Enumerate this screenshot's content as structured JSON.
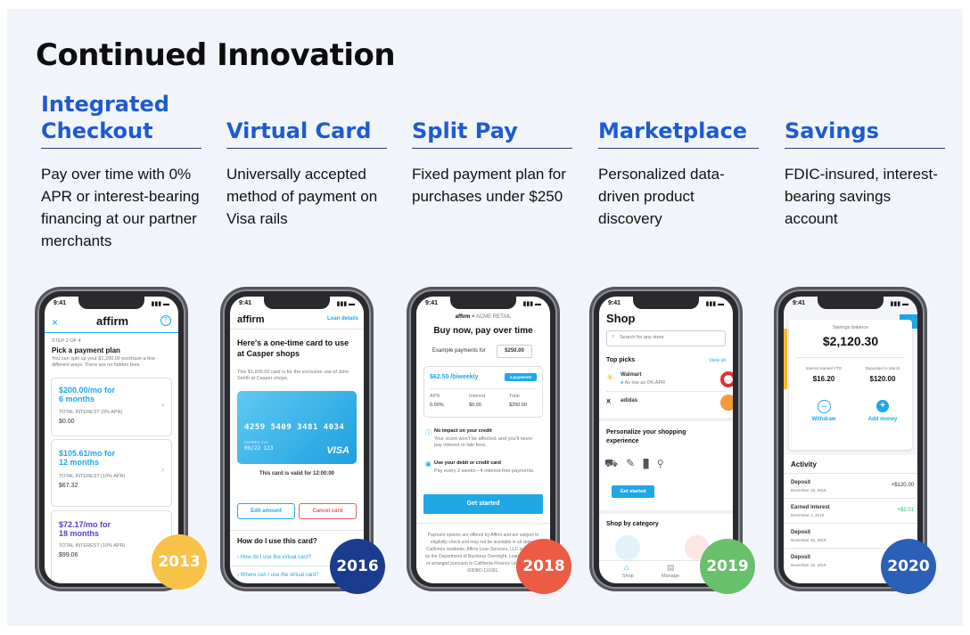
{
  "page": {
    "title": "Continued Innovation"
  },
  "columns": [
    {
      "title": "Integrated Checkout",
      "description": "Pay over time with 0% APR or interest-bearing financing at our partner merchants",
      "year": "2013",
      "badge_color": "#f7c248"
    },
    {
      "title": "Virtual Card",
      "description": "Universally accepted method of payment on Visa rails",
      "year": "2016",
      "badge_color": "#1b3b8f"
    },
    {
      "title": "Split Pay",
      "description": "Fixed payment plan for purchases under $250",
      "year": "2018",
      "badge_color": "#ec5b44"
    },
    {
      "title": "Marketplace",
      "description": "Personalized data-driven product discovery",
      "year": "2019",
      "badge_color": "#69c06a"
    },
    {
      "title": "Savings",
      "description": "FDIC-insured, interest-bearing savings account",
      "year": "2020",
      "badge_color": "#2b5fb8"
    }
  ],
  "phone1": {
    "time": "9:41",
    "close": "×",
    "logo": "affirm",
    "help": "?",
    "step": "STEP 2 OF 4",
    "heading": "Pick a payment plan",
    "sub": "You can split up your $1,200.00 purchase a few different ways. There are no hidden fees.",
    "plans": [
      {
        "amount": "$200.00/mo for 6 months",
        "label": "TOTAL INTEREST (0% APR)",
        "value": "$0.00"
      },
      {
        "amount": "$105.61/mo for 12 months",
        "label": "TOTAL INTEREST (10% APR)",
        "value": "$67.32"
      },
      {
        "amount": "$72.17/mo for 18 months",
        "label": "TOTAL INTEREST (10% APR)",
        "value": "$99.06"
      }
    ]
  },
  "phone2": {
    "time": "9:41",
    "logo": "affirm",
    "link": "Loan details",
    "heading": "Here's a one-time card to use at Casper shops",
    "sub": "This $1,200.00 card is for the exclusive use of John Smith at Casper shops.",
    "card_number": "4259 5409 3481 4034",
    "card_exp_label": "EXPIRES  CVV",
    "card_exp": "09/22  123",
    "card_brand": "VISA",
    "valid": "This card is valid for 12:00:00",
    "edit": "Edit amount",
    "cancel": "Cancel card",
    "faq_title": "How do I use this card?",
    "faq": [
      "How do I use the virtual card?",
      "Where can I use the virtual card?"
    ]
  },
  "phone3": {
    "time": "9:41",
    "logo": "affirm",
    "partner": "ACME RETAIL",
    "heading": "Buy now, pay over time",
    "example_label": "Example payments for",
    "example_value": "$250.00",
    "biweekly": "$62.50 /biweekly",
    "payments_pill": "4 payments",
    "cols": [
      "APR",
      "Interest",
      "Total"
    ],
    "vals": [
      "0.00%",
      "$0.00",
      "$250.00"
    ],
    "info1_title": "No impact on your credit",
    "info1": "Your score won't be affected, and you'll never pay interest or late fees.",
    "info2_title": "Use your debit or credit card",
    "info2": "Pay every 2 weeks—4 interest-free payments.",
    "cta": "Get started",
    "disclaimer": "Payment options are offered by Affirm and are subject to eligibility check and may not be available in all states. California residents: Affirm Loan Services, LLC is licensed by the Department of Business Oversight. Loans are made or arranged pursuant to California Finance Lender license 60DBO-111681."
  },
  "phone4": {
    "time": "9:41",
    "title": "Shop",
    "search_placeholder": "Search for any store",
    "top_picks": "Top picks",
    "view_all": "View all",
    "stores": [
      {
        "name": "Walmart",
        "sub": "As low as 0% APR"
      },
      {
        "name": "adidas",
        "sub": ""
      }
    ],
    "personalize": "Personalize your shopping experience",
    "cta": "Get started",
    "category": "Shop by category",
    "tabs": [
      "Shop",
      "Manage"
    ]
  },
  "phone5": {
    "time": "9:41",
    "balance_label": "Savings balance",
    "balance": "$2,120.30",
    "interest_label": "Interest earned YTD",
    "interest": "$16.20",
    "deposited_label": "Deposited in March",
    "deposited": "$120.00",
    "withdraw": "Withdraw",
    "add": "Add money",
    "activity": "Activity",
    "rows": [
      {
        "title": "Deposit",
        "date": "December 15, 2019",
        "amount": "+$120.00"
      },
      {
        "title": "Earned interest",
        "date": "December 1, 2019",
        "amount": "+$2.01"
      },
      {
        "title": "Deposit",
        "date": "November 30, 2019",
        "amount": ""
      },
      {
        "title": "Deposit",
        "date": "November 15, 2019",
        "amount": ""
      }
    ]
  }
}
